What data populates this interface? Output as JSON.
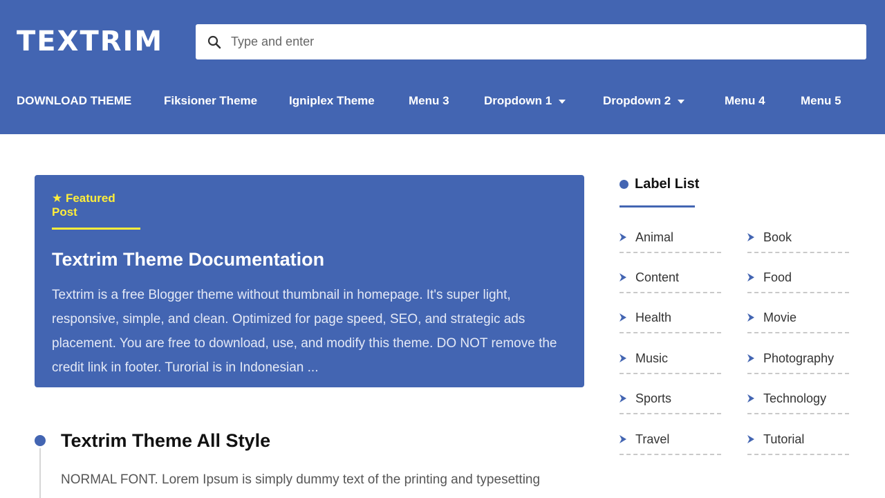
{
  "header": {
    "logo": "TEXTRIM",
    "search_placeholder": "Type and enter"
  },
  "nav": {
    "items": [
      {
        "label": "DOWNLOAD THEME"
      },
      {
        "label": "Fiksioner Theme"
      },
      {
        "label": "Igniplex Theme"
      },
      {
        "label": "Menu 3"
      },
      {
        "label": "Dropdown 1"
      },
      {
        "label": "Dropdown 2"
      },
      {
        "label": "Menu 4"
      },
      {
        "label": "Menu 5"
      }
    ]
  },
  "featured": {
    "label": "★ Featured Post",
    "title": "Textrim Theme Documentation",
    "description": "Textrim is a free Blogger theme without thumbnail in homepage. It's super light, responsive, simple, and clean. Optimized for page speed, SEO, and strategic ads placement. You are free to download, use, and modify this theme. DO NOT remove the credit link in footer. Turorial is in Indonesian ..."
  },
  "post": {
    "title": "Textrim Theme All Style",
    "excerpt": "NORMAL FONT. Lorem Ipsum is simply dummy text of the printing and typesetting"
  },
  "sidebar": {
    "heading": "Label List",
    "labels": [
      "Animal",
      "Book",
      "Content",
      "Food",
      "Health",
      "Movie",
      "Music",
      "Photography",
      "Sports",
      "Technology",
      "Travel",
      "Tutorial"
    ]
  },
  "colors": {
    "brand_blue": "#4365b2",
    "featured_accent": "#ffee3a"
  }
}
